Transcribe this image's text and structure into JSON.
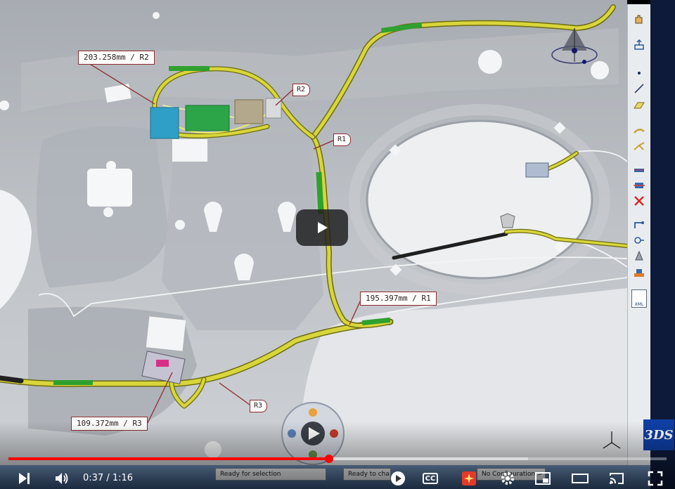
{
  "viewport": {
    "callouts": [
      {
        "id": "c1",
        "text": "203.258mm / R2"
      },
      {
        "id": "c2",
        "text": "195.397mm / R1"
      },
      {
        "id": "c3",
        "text": "109.372mm / R3"
      }
    ],
    "radius_tags": [
      {
        "id": "r1",
        "text": "R1"
      },
      {
        "id": "r2",
        "text": "R2"
      },
      {
        "id": "r3",
        "text": "R3"
      }
    ],
    "compass_icon": "compass-icon",
    "logo_text": "3DS"
  },
  "toolbar": {
    "icons": [
      "hand-icon",
      "export-icon",
      "point-icon",
      "line-icon",
      "plane-icon",
      "harness-bundle-icon",
      "branch-icon",
      "bundle-segment-icon",
      "connector-icon",
      "delete-segment-icon",
      "routing-icon",
      "protection-icon",
      "support-icon",
      "clip-icon",
      "xml-icon"
    ],
    "xml_label": "XML"
  },
  "statusbar": {
    "fields": [
      {
        "id": "s1",
        "text": "Ready for selection"
      },
      {
        "id": "s2",
        "text": "Ready to cha"
      },
      {
        "id": "s3",
        "text": "No Configuration >"
      }
    ]
  },
  "video": {
    "current_time": "0:37",
    "separator": " / ",
    "duration": "1:16",
    "progress_fraction": 0.487,
    "loaded_fraction": 0.79,
    "cc_label": "CC"
  },
  "colors": {
    "harness": "#d8d63a",
    "harness_outline": "#6d6b12",
    "callout_border": "#8e2b2b",
    "progress": "#ff0000",
    "logo": "#0f3fa6"
  }
}
